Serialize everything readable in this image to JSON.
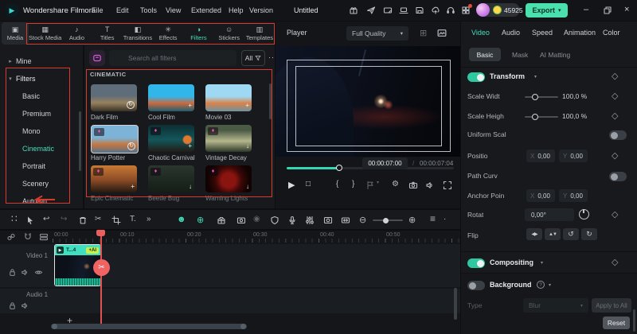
{
  "titlebar": {
    "app_name": "Wondershare Filmora",
    "menus": [
      {
        "label": "File"
      },
      {
        "label": "Edit"
      },
      {
        "label": "Tools"
      },
      {
        "label": "View"
      },
      {
        "label": "Extended"
      },
      {
        "label": "Help"
      },
      {
        "label": "Version"
      }
    ],
    "project_title": "Untitled",
    "coin_count": "45925",
    "export_label": "Export",
    "minimize": "–",
    "close": "×"
  },
  "media_tabs": {
    "selected": "Filters",
    "tabs": [
      {
        "label": "Media",
        "icon": "▣"
      },
      {
        "label": "Stock Media",
        "icon": "▦"
      },
      {
        "label": "Audio",
        "icon": "♪"
      },
      {
        "label": "Titles",
        "icon": "T"
      },
      {
        "label": "Transitions",
        "icon": "◧"
      },
      {
        "label": "Effects",
        "icon": "✳"
      },
      {
        "label": "Filters",
        "icon": "◑"
      },
      {
        "label": "Stickers",
        "icon": "☺"
      },
      {
        "label": "Templates",
        "icon": "▥"
      }
    ]
  },
  "sidebar": {
    "mine_label": "Mine",
    "filters_label": "Filters",
    "selected": "Cinematic",
    "items": [
      {
        "label": "Basic"
      },
      {
        "label": "Premium"
      },
      {
        "label": "Mono"
      },
      {
        "label": "Cinematic"
      },
      {
        "label": "Portrait"
      },
      {
        "label": "Scenery"
      },
      {
        "label": "Autumn"
      }
    ]
  },
  "filters_panel": {
    "search_placeholder": "Search all filters",
    "all_label": "All",
    "more_label": "···",
    "section_title": "CINEMATIC",
    "items": [
      {
        "name": "Dark Film",
        "corner_icon": "↻"
      },
      {
        "name": "Cool Film",
        "corner_icon": "+"
      },
      {
        "name": "Movie 03",
        "corner_icon": "+"
      },
      {
        "name": "Harry Potter",
        "corner_icon": "↻",
        "badge": "♦"
      },
      {
        "name": "Chaotic Carnival",
        "corner_icon": "+",
        "badge": "♦"
      },
      {
        "name": "Vintage Decay",
        "corner_icon": "↓",
        "badge": "♦"
      },
      {
        "name": "Epic Cinematic",
        "corner_icon": "+",
        "badge": "♦"
      },
      {
        "name": "Beetle Bug",
        "corner_icon": "↓",
        "badge": "♦"
      },
      {
        "name": "Warning Lights",
        "corner_icon": "↓",
        "badge": "♦"
      }
    ]
  },
  "player": {
    "title": "Player",
    "quality": "Full Quality",
    "current_time": "00:00:07:00",
    "time_separator": "/",
    "total_time": "00:00:07:04"
  },
  "properties": {
    "selected_tab": "Video",
    "tabs": [
      {
        "label": "Video"
      },
      {
        "label": "Audio"
      },
      {
        "label": "Speed"
      },
      {
        "label": "Animation"
      },
      {
        "label": "Color"
      }
    ],
    "selected_subtab": "Basic",
    "subtabs": [
      {
        "label": "Basic"
      },
      {
        "label": "Mask"
      },
      {
        "label": "AI Matting"
      }
    ],
    "transform": {
      "label": "Transform",
      "scale_width_label": "Scale Widt",
      "scale_width_value": "100,0 %",
      "scale_height_label": "Scale Heigh",
      "scale_height_value": "100,0 %",
      "uniform_label": "Uniform Scal",
      "position_label": "Positio",
      "x_prefix": "X",
      "y_prefix": "Y",
      "position_x": "0,00",
      "position_y": "0,00",
      "path_label": "Path Curv",
      "anchor_label": "Anchor Poin",
      "anchor_x": "0,00",
      "anchor_y": "0,00",
      "rotate_label": "Rotat",
      "rotate_value": "0,00°",
      "flip_label": "Flip"
    },
    "compositing_label": "Compositing",
    "background_label": "Background",
    "type_label": "Type",
    "type_value": "Blur",
    "apply_all_label": "Apply to All",
    "reset_label": "Reset"
  },
  "timeline": {
    "ruler": [
      {
        "label": "00:00"
      },
      {
        "label": "00:10"
      },
      {
        "label": "00:20"
      },
      {
        "label": "00:30"
      },
      {
        "label": "00:40"
      },
      {
        "label": "00:50"
      }
    ],
    "video_track_label": "Video 1",
    "audio_track_label": "Audio 1",
    "clip_label": "T...4",
    "ai_badge": "+AI",
    "add_track_label": "+"
  },
  "icons": {
    "logo_play": "▶",
    "chevron_down": "▾",
    "chevron_right": "▸",
    "play": "▶",
    "stop": "□",
    "brace_open": "{",
    "brace_close": "}",
    "gear": "⚙",
    "diamond": "◇",
    "question": "?",
    "flip_h": "◀▶",
    "flip_v": "▲▼",
    "rotate_ccw": "↺",
    "rotate_cw": "↻",
    "apps": "∷",
    "undo": "↩",
    "redo": "↪",
    "scissors": "✂",
    "text_tool": "T.",
    "more": "»",
    "ai_face": "☻",
    "compass": "⊕",
    "record": "◉",
    "zoom_out": "⊖",
    "zoom_in": "⊕",
    "track_list": "≡",
    "dot": "·",
    "player_grid": "⊞"
  },
  "colors": {
    "accent_teal": "#49dcbe",
    "annotation_red": "#d93a2e",
    "export_green": "#49e0ae",
    "playhead_red": "#e05252",
    "ai_badge_green": "#c9ee4f",
    "gem_pink": "#f153c4"
  }
}
